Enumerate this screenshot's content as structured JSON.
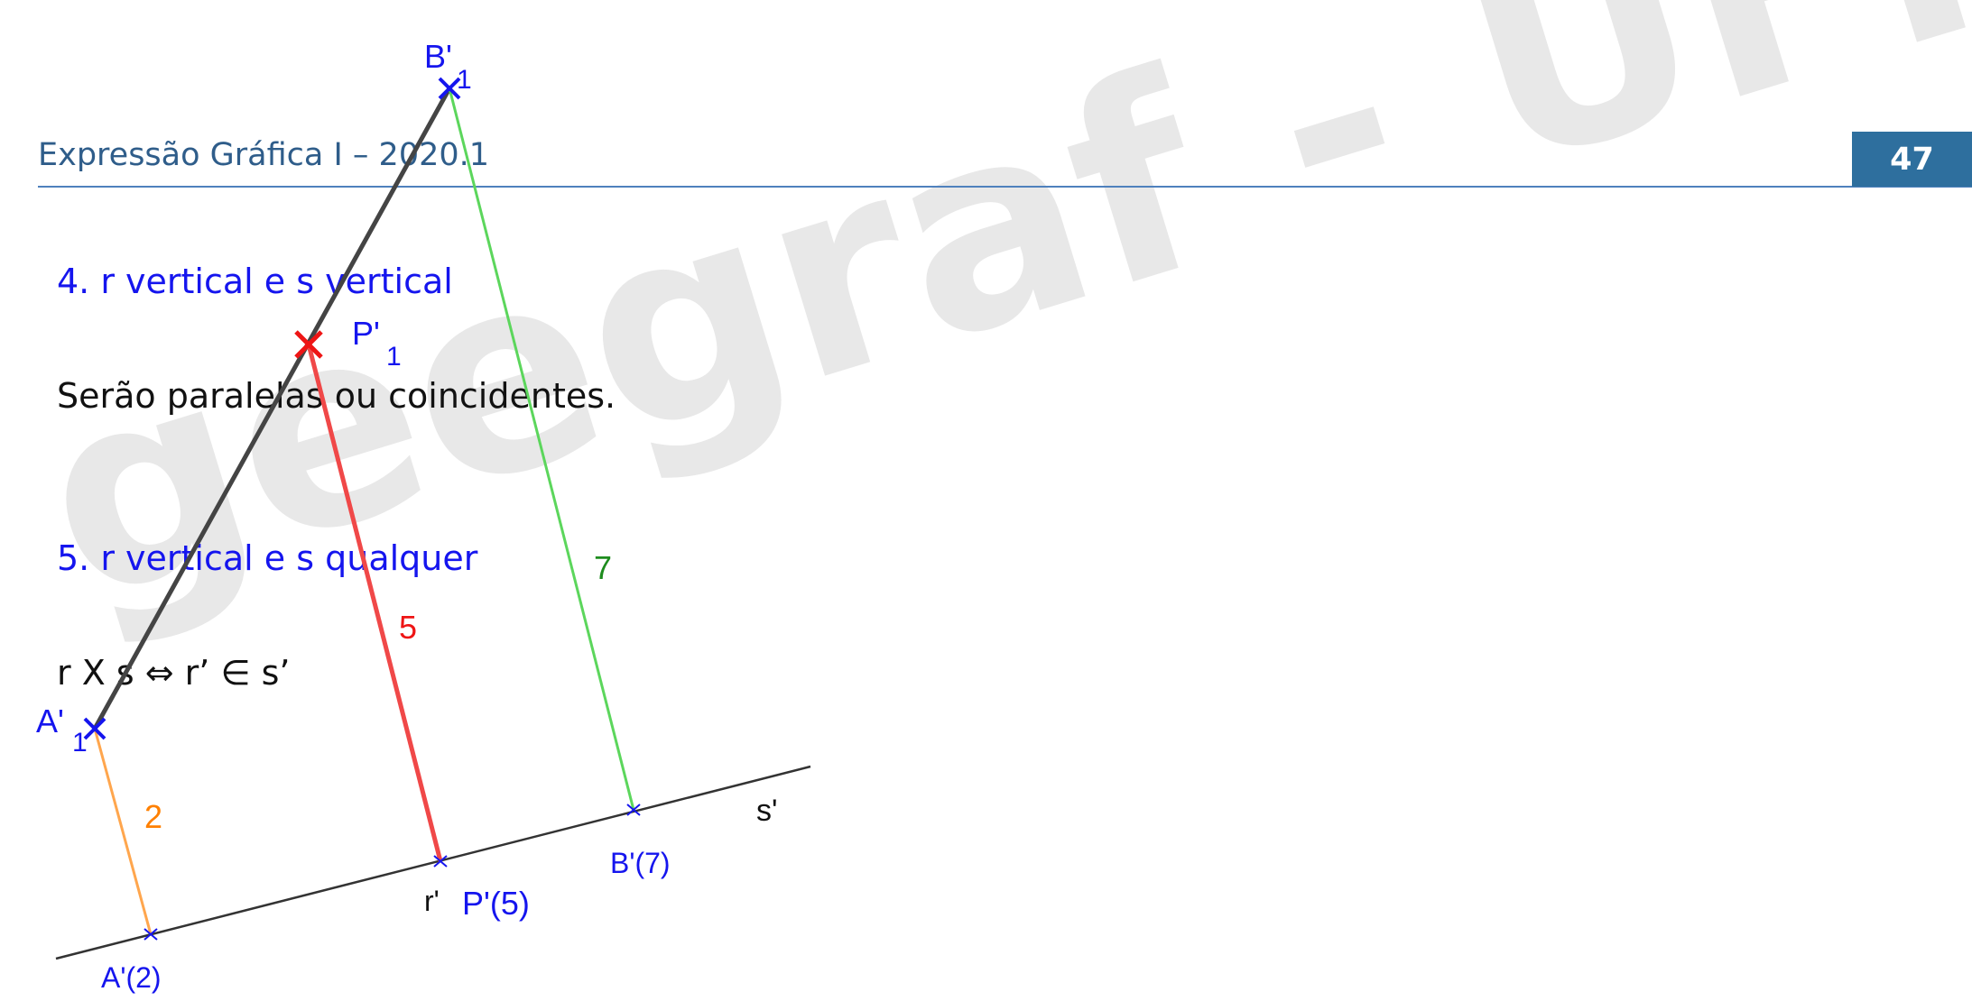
{
  "header": {
    "title": "Expressão Gráfica I – 2020.1",
    "page_number": "47"
  },
  "watermark": "geegraf - UFPR",
  "sections": {
    "s4_heading": "4. r vertical e s vertical",
    "s4_text": "Serão paralelas ou coincidentes.",
    "s5_heading": "5. r vertical e s qualquer",
    "s5_text": "r X s ⇔ r’ ∈ s’"
  },
  "diagram": {
    "labels": {
      "b1_main": "B'",
      "b1_sub": "1",
      "p1_main": "P'",
      "p1_sub": "1",
      "a1_main": "A'",
      "a1_sub": "1",
      "line7": "7",
      "line5": "5",
      "line2": "2",
      "s_prime": "s'",
      "b7": "B'(7)",
      "r_prime": "r'",
      "p5": "P'(5)",
      "a2": "A'(2)"
    },
    "colors": {
      "blue": "#1515ee",
      "red": "#ee1515",
      "green": "#1e8c1e",
      "orange": "#ff8000",
      "dark": "#333333",
      "line_green": "#5cd65c",
      "line_red": "#f04848",
      "line_orange": "#ffa64d"
    }
  }
}
